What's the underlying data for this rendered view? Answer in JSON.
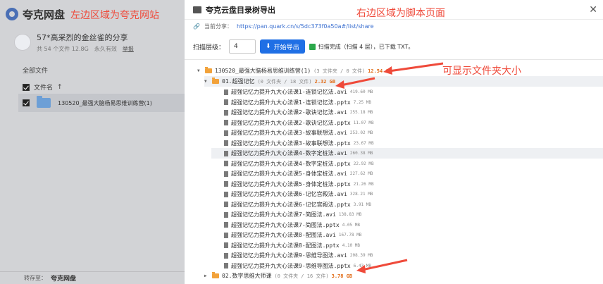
{
  "left": {
    "logo_text": "夸克网盘",
    "annotation": "左边区域为夸克网站",
    "share_title": "57*高采烈的金丝雀的分享",
    "share_meta": "共 54 个文件 12.8G",
    "share_expiry": "永久有效",
    "share_report": "举报",
    "all_files": "全部文件",
    "header_filename": "文件名",
    "header_sort": "↑",
    "file_name": "130520_最强大脑杨易思维训练营(1)",
    "save_label": "转存至：",
    "save_target": "夸克网盘"
  },
  "panel": {
    "title": "夸克云盘目录树导出",
    "annotation": "右边区域为脚本页面",
    "share_label": "当前分享：",
    "share_url": "https://pan.quark.cn/s/5dc373f0a50a#/list/share",
    "scan_label": "扫描层级：",
    "scan_depth": "4",
    "start_button": "开始导出",
    "status": "扫描完成（扫描 4 层），已下载 TXT。",
    "annotation_size": "可显示文件夹大小"
  },
  "tree": {
    "root": {
      "name": "130520_最强大脑杨易思维训练营(1)",
      "counts": "(3 文件夹 / 0 文件)",
      "size": "12.54 GB"
    },
    "sub1": {
      "name": "01.超强记忆",
      "counts": "(0 文件夹 / 18 文件)",
      "size": "2.32 GB"
    },
    "files": [
      {
        "name": "超强记忆力提升九大心法课1-连锁记忆法.avi",
        "size": "419.60 MB"
      },
      {
        "name": "超强记忆力提升九大心法课1-连锁记忆法.pptx",
        "size": "7.25 MB"
      },
      {
        "name": "超强记忆力提升九大心法课2-歌诀记忆法.avi",
        "size": "255.18 MB"
      },
      {
        "name": "超强记忆力提升九大心法课2-歌诀记忆法.pptx",
        "size": "11.07 MB"
      },
      {
        "name": "超强记忆力提升九大心法课3-故事联想法.avi",
        "size": "253.02 MB"
      },
      {
        "name": "超强记忆力提升九大心法课3-故事联想法.pptx",
        "size": "23.67 MB"
      },
      {
        "name": "超强记忆力提升九大心法课4-数字定桩法.avi",
        "size": "260.38 MB"
      },
      {
        "name": "超强记忆力提升九大心法课4-数字定桩法.pptx",
        "size": "22.92 MB"
      },
      {
        "name": "超强记忆力提升九大心法课5-身体定桩法.avi",
        "size": "227.62 MB"
      },
      {
        "name": "超强记忆力提升九大心法课5-身体定桩法.pptx",
        "size": "21.26 MB"
      },
      {
        "name": "超强记忆力提升九大心法课6-记忆宫殿法.avi",
        "size": "328.21 MB"
      },
      {
        "name": "超强记忆力提升九大心法课6-记忆宫殿法.pptx",
        "size": "3.91 MB"
      },
      {
        "name": "超强记忆力提升九大心法课7-简图法.avi",
        "size": "138.83 MB"
      },
      {
        "name": "超强记忆力提升九大心法课7-简图法.pptx",
        "size": "4.05 MB"
      },
      {
        "name": "超强记忆力提升九大心法课8-配图法.avi",
        "size": "167.78 MB"
      },
      {
        "name": "超强记忆力提升九大心法课8-配图法.pptx",
        "size": "4.10 MB"
      },
      {
        "name": "超强记忆力提升九大心法课9-思维导图法.avi",
        "size": "208.39 MB"
      },
      {
        "name": "超强记忆力提升九大心法课9-思维导图法.pptx",
        "size": "6.43 MB"
      }
    ],
    "sub2": {
      "name": "02.数字思维大师课",
      "counts": "(0 文件夹 / 16 文件)",
      "size": "3.78 GB"
    }
  },
  "colors": {
    "accent": "#1f6fe5",
    "folder": "#f2a23a",
    "size": "#e06a14",
    "annotation": "#ef4a3a"
  }
}
